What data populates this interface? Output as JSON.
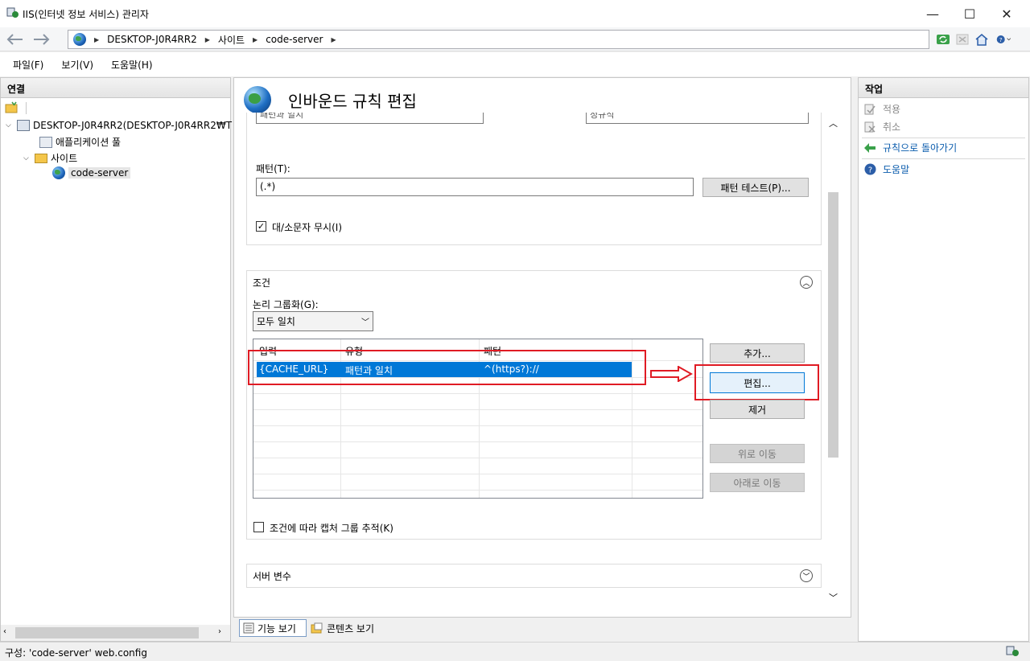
{
  "window": {
    "title": "IIS(인터넷 정보 서비스) 관리자",
    "minimize": "—",
    "maximize": "☐",
    "close": "✕"
  },
  "address": {
    "crumbs": [
      "DESKTOP-J0R4RR2",
      "사이트",
      "code-server"
    ]
  },
  "menu": [
    "파일(F)",
    "보기(V)",
    "도움말(H)"
  ],
  "connections": {
    "header": "연결",
    "server": "DESKTOP-J0R4RR2(DESKTOP-J0R4RR2₩T",
    "app_pools": "애플리케이션 풀",
    "sites": "사이트",
    "site": "code-server"
  },
  "page": {
    "title": "인바운드 규칙 편집",
    "top_combo_left": "패턴과 일치",
    "top_combo_right": "정규식",
    "pattern_label": "패턴(T):",
    "pattern_value": "(.*)",
    "test_pattern_button": "패턴 테스트(P)...",
    "ignore_case_label": "대/소문자 무시(I)",
    "ignore_case_check": "✓"
  },
  "conditions": {
    "header": "조건",
    "logical_grouping_label": "논리 그룹화(G):",
    "logical_grouping_value": "모두 일치",
    "columns": [
      "입력",
      "유형",
      "패턴"
    ],
    "rows": [
      {
        "input": "{CACHE_URL}",
        "type": "패턴과 일치",
        "pattern": "^(https?)://"
      }
    ],
    "buttons": {
      "add": "추가...",
      "edit": "편집...",
      "remove": "제거",
      "move_up": "위로 이동",
      "move_down": "아래로 이동"
    },
    "track_capture_label": "조건에 따라 캡처 그룹 추적(K)"
  },
  "server_variables": {
    "header": "서버 변수"
  },
  "view_tabs": {
    "features": "기능 보기",
    "content": "콘텐츠 보기"
  },
  "actions": {
    "header": "작업",
    "apply": "적용",
    "cancel": "취소",
    "back_to_rules": "규칙으로 돌아가기",
    "help": "도움말"
  },
  "status": {
    "text": "구성: 'code-server' web.config"
  },
  "colors": {
    "selection": "#0078d7",
    "highlight_red": "#e01b24",
    "link": "#0b5cad"
  }
}
